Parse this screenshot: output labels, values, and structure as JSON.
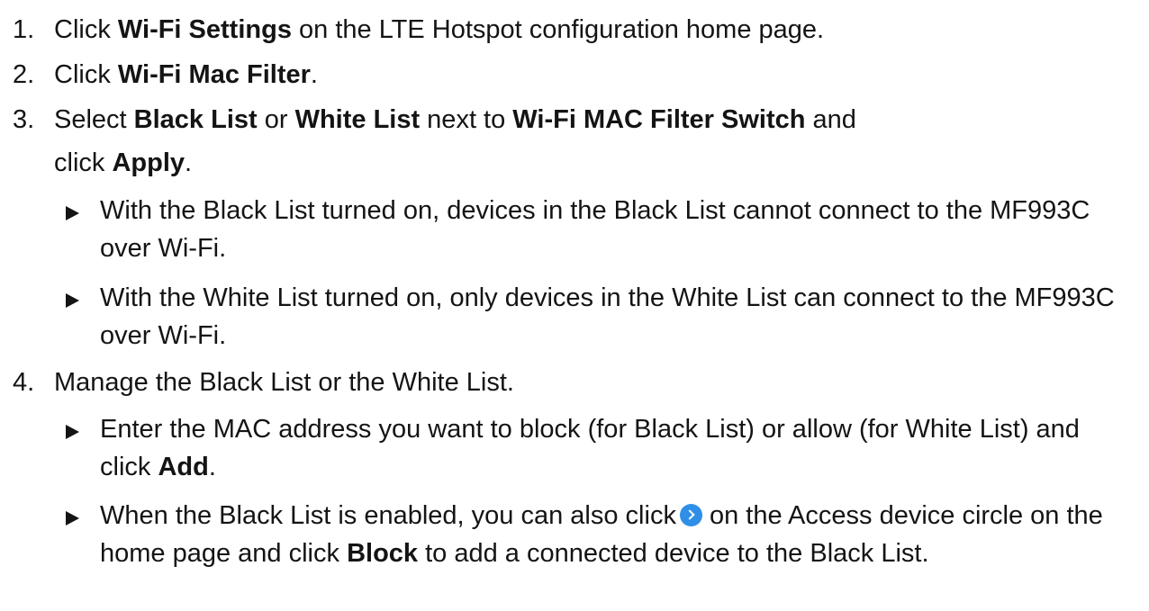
{
  "steps": [
    {
      "num": "1.",
      "pre": "Click ",
      "b1": "Wi-Fi Settings",
      "post": " on the LTE Hotspot configuration home page."
    },
    {
      "num": "2.",
      "pre": "Click ",
      "b1": "Wi-Fi Mac Filter",
      "post": "."
    },
    {
      "num": "3.",
      "pre": "Select ",
      "b1": "Black List",
      "mid1": " or ",
      "b2": "White List",
      "mid2": " next to ",
      "b3": "Wi-Fi MAC Filter Switch",
      "mid3": " and",
      "line2_pre": "click ",
      "b4": "Apply",
      "line2_post": ".",
      "bullets": [
        "With the Black List turned on, devices in the Black List cannot connect to the MF993C over Wi-Fi.",
        "With the White List turned on, only devices in the White List can connect to the MF993C over Wi-Fi."
      ]
    },
    {
      "num": "4.",
      "text": "Manage the Black List or the White List.",
      "bullet1_pre": "Enter the MAC address you want to block (for Black List) or allow (for White List) and click ",
      "bullet1_bold": "Add",
      "bullet1_post": ".",
      "bullet2_pre": "When the Black List is enabled, you can also click",
      "bullet2_mid": "on the Access device circle on the home page and click ",
      "bullet2_bold": "Block",
      "bullet2_post": " to add a connected device to the Black List."
    }
  ],
  "icons": {
    "bullet": "triangle-right-icon",
    "inline": "blue-circle-chevron-right-icon",
    "inline_color": "#2f8fe6"
  }
}
